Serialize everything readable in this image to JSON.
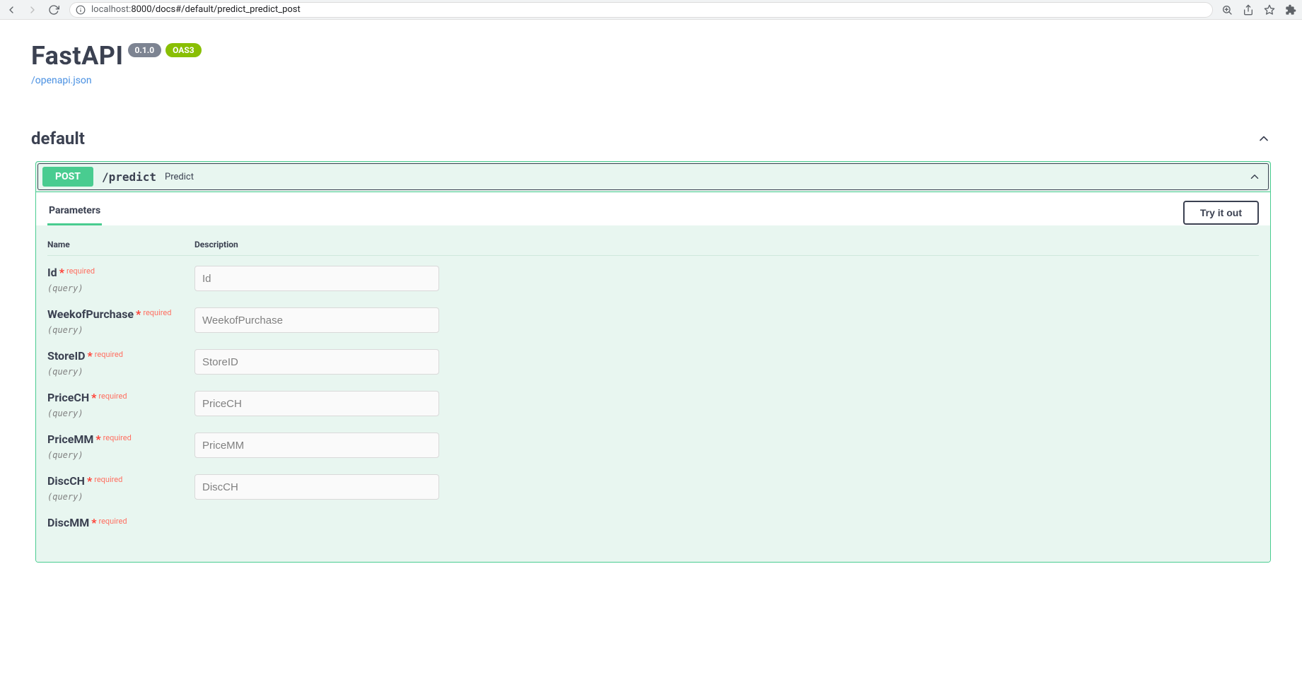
{
  "browser": {
    "url_host": "localhost:",
    "url_rest": "8000/docs#/default/predict_predict_post"
  },
  "header": {
    "title": "FastAPI",
    "version_badge": "0.1.0",
    "oas_badge": "OAS3",
    "openapi_link": "/openapi.json"
  },
  "section": {
    "name": "default"
  },
  "operation": {
    "method": "POST",
    "path": "/predict",
    "summary": "Predict",
    "tabs": {
      "parameters": "Parameters"
    },
    "try_it_out": "Try it out",
    "table": {
      "name_header": "Name",
      "desc_header": "Description"
    },
    "required_label": "required",
    "location_label": "(query)",
    "params": [
      {
        "name": "Id",
        "placeholder": "Id"
      },
      {
        "name": "WeekofPurchase",
        "placeholder": "WeekofPurchase"
      },
      {
        "name": "StoreID",
        "placeholder": "StoreID"
      },
      {
        "name": "PriceCH",
        "placeholder": "PriceCH"
      },
      {
        "name": "PriceMM",
        "placeholder": "PriceMM"
      },
      {
        "name": "DiscCH",
        "placeholder": "DiscCH"
      },
      {
        "name": "DiscMM",
        "placeholder": ""
      }
    ]
  }
}
